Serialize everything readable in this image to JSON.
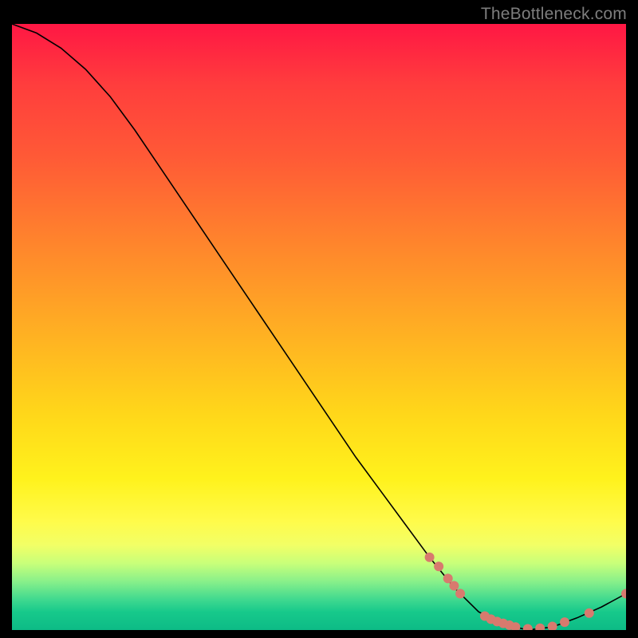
{
  "watermark": "TheBottleneck.com",
  "chart_data": {
    "type": "line",
    "title": "",
    "xlabel": "",
    "ylabel": "",
    "xlim": [
      0,
      100
    ],
    "ylim": [
      0,
      100
    ],
    "curve": {
      "name": "bottleneck-curve",
      "x": [
        0,
        4,
        8,
        12,
        16,
        20,
        24,
        28,
        32,
        36,
        40,
        44,
        48,
        52,
        56,
        60,
        64,
        68,
        72,
        76,
        80,
        84,
        88,
        92,
        96,
        100
      ],
      "y": [
        100,
        98.5,
        96,
        92.5,
        88,
        82.5,
        76.5,
        70.5,
        64.5,
        58.5,
        52.5,
        46.5,
        40.5,
        34.5,
        28.5,
        23,
        17.5,
        12,
        7,
        3,
        1,
        0,
        0.5,
        2,
        3.8,
        6
      ]
    },
    "markers": [
      {
        "x": 68,
        "y": 12.0
      },
      {
        "x": 69.5,
        "y": 10.5
      },
      {
        "x": 71,
        "y": 8.5
      },
      {
        "x": 72,
        "y": 7.3
      },
      {
        "x": 73,
        "y": 6.0
      },
      {
        "x": 77,
        "y": 2.3
      },
      {
        "x": 78,
        "y": 1.8
      },
      {
        "x": 79,
        "y": 1.4
      },
      {
        "x": 80,
        "y": 1.1
      },
      {
        "x": 81,
        "y": 0.8
      },
      {
        "x": 82,
        "y": 0.5
      },
      {
        "x": 84,
        "y": 0.2
      },
      {
        "x": 86,
        "y": 0.3
      },
      {
        "x": 88,
        "y": 0.6
      },
      {
        "x": 90,
        "y": 1.3
      },
      {
        "x": 94,
        "y": 2.8
      },
      {
        "x": 100,
        "y": 6.0
      }
    ],
    "marker_color": "#d87a6e",
    "curve_color": "#000000"
  }
}
